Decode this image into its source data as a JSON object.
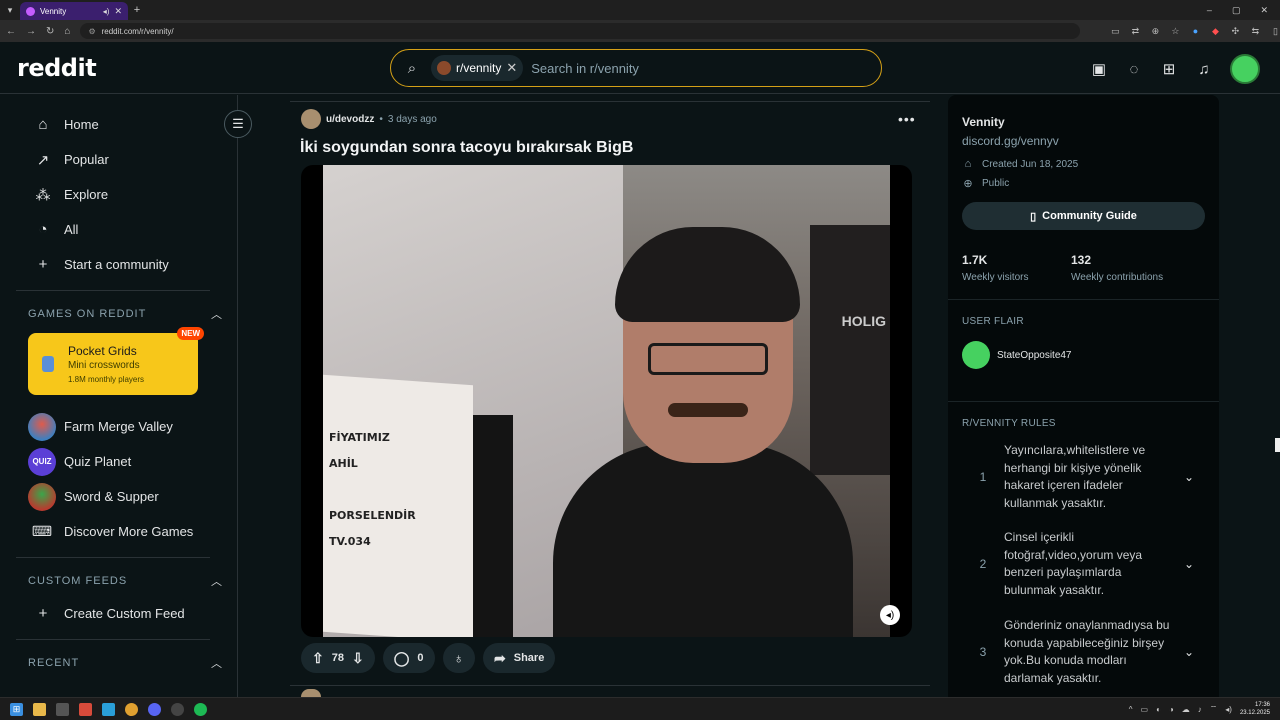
{
  "browser": {
    "tab_title": "Vennity",
    "url": "reddit.com/r/vennity/"
  },
  "header": {
    "logo": "reddit",
    "search_chip": "r/vennity",
    "search_placeholder": "Search in r/vennity"
  },
  "sidebar": {
    "nav": [
      {
        "label": "Home",
        "icon": "home-icon"
      },
      {
        "label": "Popular",
        "icon": "popular-icon"
      },
      {
        "label": "Explore",
        "icon": "explore-icon"
      },
      {
        "label": "All",
        "icon": "all-icon"
      },
      {
        "label": "Start a community",
        "icon": "plus-icon"
      }
    ],
    "games_heading": "GAMES ON REDDIT",
    "promo": {
      "title": "Pocket Grids",
      "subtitle": "Mini crosswords",
      "players": "1.8M monthly players",
      "badge": "NEW"
    },
    "games": [
      {
        "label": "Farm Merge Valley"
      },
      {
        "label": "Quiz Planet"
      },
      {
        "label": "Sword & Supper"
      },
      {
        "label": "Discover More Games"
      }
    ],
    "custom_feeds_heading": "CUSTOM FEEDS",
    "create_feed": "Create Custom Feed",
    "recent_heading": "RECENT"
  },
  "post": {
    "author": "u/devodzz",
    "separator": "•",
    "time": "3 days ago",
    "title": "İki soygundan sonra tacoyu bırakırsak BigB",
    "video_sign_text": "FİYATIMIZ\nAHİL\n\nPORSELENDİR\nTV.034",
    "video_chair_text": "HOLIG",
    "votes": "78",
    "comments": "0",
    "share_label": "Share"
  },
  "subreddit": {
    "name": "Vennity",
    "link": "discord.gg/vennyv",
    "created": "Created Jun 18, 2025",
    "visibility": "Public",
    "guide_button": "Community Guide",
    "weekly_visitors_value": "1.7K",
    "weekly_visitors_label": "Weekly visitors",
    "weekly_contrib_value": "132",
    "weekly_contrib_label": "Weekly contributions",
    "flair_heading": "USER FLAIR",
    "flair_user": "StateOpposite47",
    "rules_heading": "R/VENNITY RULES",
    "rules": [
      {
        "num": "1",
        "text": "Yayıncılara,whitelistlere ve herhangi bir kişiye yönelik hakaret içeren ifadeler kullanmak yasaktır."
      },
      {
        "num": "2",
        "text": "Cinsel içerikli fotoğraf,video,yorum veya benzeri paylaşımlarda bulunmak yasaktır."
      },
      {
        "num": "3",
        "text": "Gönderiniz onaylanmadıysa bu konuda yapabileceğiniz birşey yok.Bu konuda modları darlamak yasaktır."
      }
    ]
  },
  "taskbar": {
    "time": "17:36",
    "date": "23.12.2025"
  },
  "colors": {
    "bg": "#0b1416",
    "search_border": "#d4a017",
    "promo_bg": "#f7c71a",
    "accent_orange": "#ff4500",
    "avatar_green": "#46d160"
  }
}
